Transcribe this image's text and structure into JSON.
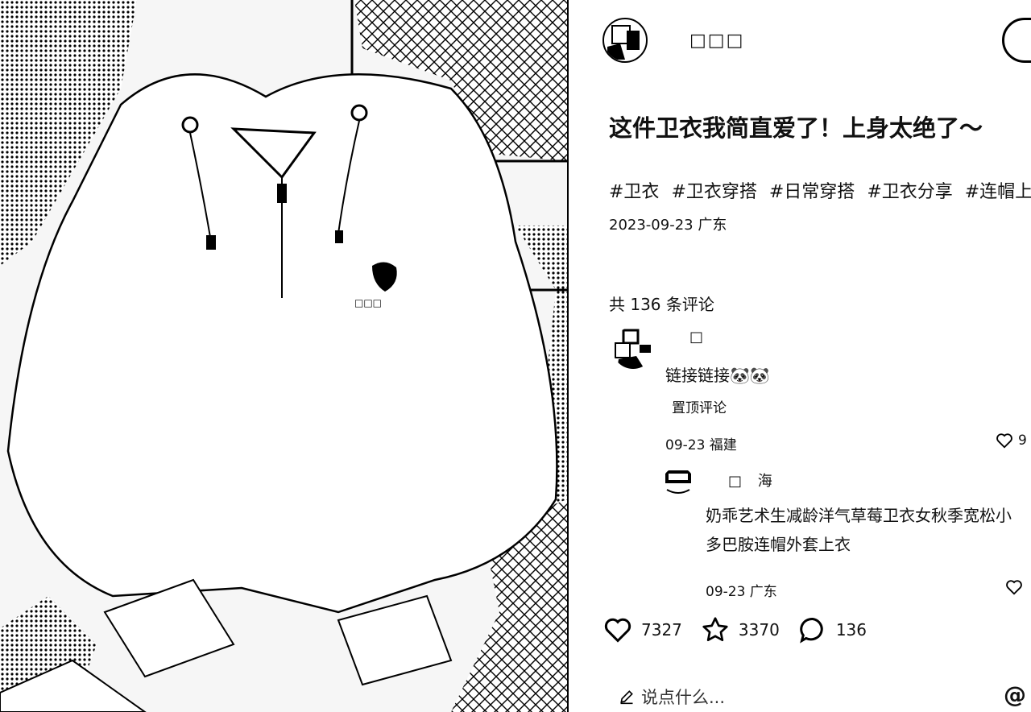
{
  "post": {
    "author_name": "□□□",
    "title": "这件卫衣我简直爱了！上身太绝了～",
    "tags": [
      "#卫衣",
      "#卫衣穿搭",
      "#日常穿搭",
      "#卫衣分享",
      "#连帽上衣"
    ],
    "meta": "2023-09-23 广东"
  },
  "comments": {
    "count_label": "共 136 条评论",
    "pinned": {
      "author": "□",
      "text": "链接链接",
      "emoji": "🐼🐼",
      "badge": "置顶评论",
      "meta": "09-23 福建",
      "likes": "9"
    },
    "reply": {
      "author": "□",
      "author_suffix": "海",
      "text_line1": "奶乖艺术生减龄洋气草莓卫衣女秋季宽松小",
      "text_line2": "多巴胺连帽外套上衣",
      "meta": "09-23 广东"
    }
  },
  "actions": {
    "likes": "7327",
    "collects": "3370",
    "comments": "136"
  },
  "input": {
    "placeholder": "说点什么..."
  },
  "icons": [
    "image-photo",
    "avatar",
    "heart-icon",
    "star-icon",
    "chat-bubble-icon",
    "pencil-icon",
    "at-icon"
  ],
  "colors": {
    "text": "#111111",
    "background": "#ffffff",
    "accent": "#000000"
  }
}
